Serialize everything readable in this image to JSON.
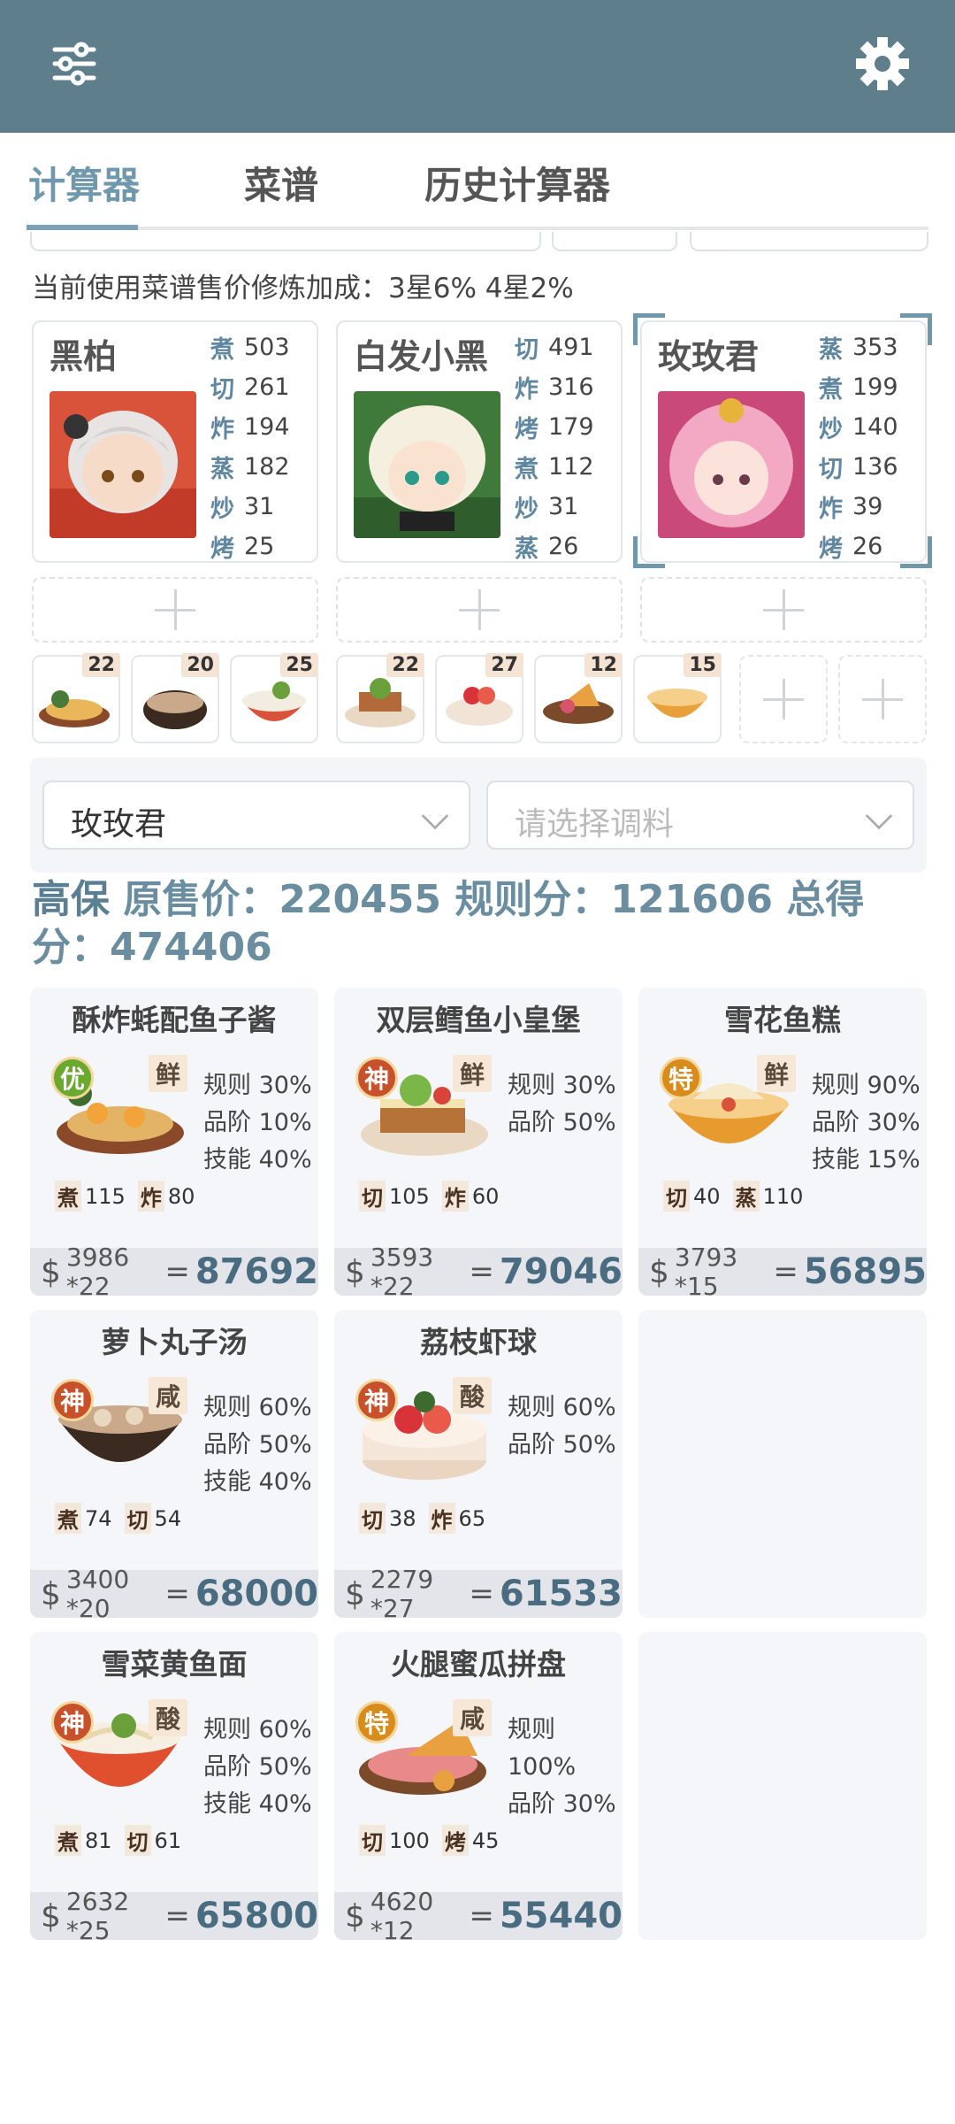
{
  "tabs": [
    "计算器",
    "菜谱",
    "历史计算器"
  ],
  "bonus_text": "当前使用菜谱售价修炼加成：3星6% 4星2%",
  "chefs": [
    {
      "name": "黑柏",
      "stats": [
        [
          "煮",
          "503"
        ],
        [
          "切",
          "261"
        ],
        [
          "炸",
          "194"
        ],
        [
          "蒸",
          "182"
        ],
        [
          "炒",
          "31"
        ],
        [
          "烤",
          "25"
        ]
      ]
    },
    {
      "name": "白发小黑",
      "stats": [
        [
          "切",
          "491"
        ],
        [
          "炸",
          "316"
        ],
        [
          "烤",
          "179"
        ],
        [
          "煮",
          "112"
        ],
        [
          "炒",
          "31"
        ],
        [
          "蒸",
          "26"
        ]
      ]
    },
    {
      "name": "玫玫君",
      "stats": [
        [
          "蒸",
          "353"
        ],
        [
          "煮",
          "199"
        ],
        [
          "炒",
          "140"
        ],
        [
          "切",
          "136"
        ],
        [
          "炸",
          "39"
        ],
        [
          "烤",
          "26"
        ]
      ]
    }
  ],
  "dish_slots": [
    "22",
    "20",
    "25",
    "22",
    "27",
    "12",
    "15"
  ],
  "selectors": {
    "chef": "玫玫君",
    "seasoning_placeholder": "请选择调料"
  },
  "summary": {
    "lead": "高保",
    "text": "原售价：220455 规则分：121606 总得分：474406"
  },
  "recipes": [
    {
      "title": "酥炸蚝配鱼子酱",
      "grade": "优",
      "flavor": "鲜",
      "rules": [
        "规则 30%",
        "品阶 10%",
        "技能 40%"
      ],
      "skills": [
        [
          "煮",
          "115"
        ],
        [
          "炸",
          "80"
        ]
      ],
      "price": "3986 *22",
      "total": "87692"
    },
    {
      "title": "双层鳕鱼小皇堡",
      "grade": "神",
      "flavor": "鲜",
      "rules": [
        "规则 30%",
        "品阶 50%"
      ],
      "skills": [
        [
          "切",
          "105"
        ],
        [
          "炸",
          "60"
        ]
      ],
      "price": "3593 *22",
      "total": "79046"
    },
    {
      "title": "雪花鱼糕",
      "grade": "特",
      "flavor": "鲜",
      "rules": [
        "规则 90%",
        "品阶 30%",
        "技能 15%"
      ],
      "skills": [
        [
          "切",
          "40"
        ],
        [
          "蒸",
          "110"
        ]
      ],
      "price": "3793 *15",
      "total": "56895"
    },
    {
      "title": "萝卜丸子汤",
      "grade": "神",
      "flavor": "咸",
      "rules": [
        "规则 60%",
        "品阶 50%",
        "技能 40%"
      ],
      "skills": [
        [
          "煮",
          "74"
        ],
        [
          "切",
          "54"
        ]
      ],
      "price": "3400 *20",
      "total": "68000"
    },
    {
      "title": "荔枝虾球",
      "grade": "神",
      "flavor": "酸",
      "rules": [
        "规则 60%",
        "品阶 50%"
      ],
      "skills": [
        [
          "切",
          "38"
        ],
        [
          "炸",
          "65"
        ]
      ],
      "price": "2279 *27",
      "total": "61533"
    },
    {
      "title": "雪菜黄鱼面",
      "grade": "神",
      "flavor": "酸",
      "rules": [
        "规则 60%",
        "品阶 50%",
        "技能 40%"
      ],
      "skills": [
        [
          "煮",
          "81"
        ],
        [
          "切",
          "61"
        ]
      ],
      "price": "2632 *25",
      "total": "65800"
    },
    {
      "title": "火腿蜜瓜拼盘",
      "grade": "特",
      "flavor": "咸",
      "rules": [
        "规则 100%",
        "品阶 30%"
      ],
      "skills": [
        [
          "切",
          "100"
        ],
        [
          "烤",
          "45"
        ]
      ],
      "price": "4620 *12",
      "total": "55440"
    }
  ],
  "grade_colors": {
    "优": "#6aa82e",
    "神": "#c8502a",
    "特": "#d98b1c"
  },
  "accent": "#5f7e8c"
}
